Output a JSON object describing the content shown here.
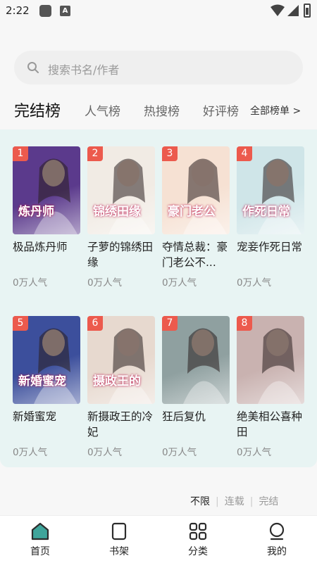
{
  "status_bar": {
    "time": "2:22",
    "app_icon_letter": "A"
  },
  "search": {
    "placeholder": "搜索书名/作者"
  },
  "tabs": {
    "items": [
      {
        "label": "完结榜",
        "active": true
      },
      {
        "label": "人气榜",
        "active": false
      },
      {
        "label": "热搜榜",
        "active": false
      },
      {
        "label": "好评榜",
        "active": false
      }
    ],
    "all_label": "全部榜单 >"
  },
  "books": [
    {
      "rank": "1",
      "title": "极品炼丹师",
      "popularity": "0万人气",
      "cover_text": "炼丹师",
      "cover_color": "#5b3a8c"
    },
    {
      "rank": "2",
      "title": "子萝的锦绣田缘",
      "popularity": "0万人气",
      "cover_text": "锦绣田缘",
      "cover_color": "#f1ebe4"
    },
    {
      "rank": "3",
      "title": "夺情总裁：豪门老公不...",
      "popularity": "0万人气",
      "cover_text": "豪门老公",
      "cover_color": "#f6e1d3"
    },
    {
      "rank": "4",
      "title": "宠妾作死日常",
      "popularity": "0万人气",
      "cover_text": "作死日常",
      "cover_color": "#cfe5e8"
    },
    {
      "rank": "5",
      "title": "新婚蜜宠",
      "popularity": "0万人气",
      "cover_text": "新婚蜜宠",
      "cover_color": "#3c4f9c"
    },
    {
      "rank": "6",
      "title": "新摄政王的冷妃",
      "popularity": "0万人气",
      "cover_text": "摄政王的",
      "cover_color": "#e7d9cf"
    },
    {
      "rank": "7",
      "title": "狂后复仇",
      "popularity": "0万人气",
      "cover_text": "",
      "cover_color": "#8fa0a0"
    },
    {
      "rank": "8",
      "title": "绝美相公喜种田",
      "popularity": "0万人气",
      "cover_text": "",
      "cover_color": "#c9b2b0"
    }
  ],
  "filters": {
    "options": [
      {
        "label": "不限",
        "selected": true
      },
      {
        "label": "连载",
        "selected": false
      },
      {
        "label": "完结",
        "selected": false
      }
    ]
  },
  "nav": {
    "items": [
      {
        "label": "首页",
        "icon": "home-icon",
        "active": true
      },
      {
        "label": "书架",
        "icon": "bookshelf-icon",
        "active": false
      },
      {
        "label": "分类",
        "icon": "category-grid-icon",
        "active": false
      },
      {
        "label": "我的",
        "icon": "profile-icon",
        "active": false
      }
    ]
  },
  "colors": {
    "accent": "#3fa59b",
    "panel_bg": "#e8f4f3",
    "rank_badge": "#ec5a4d"
  }
}
